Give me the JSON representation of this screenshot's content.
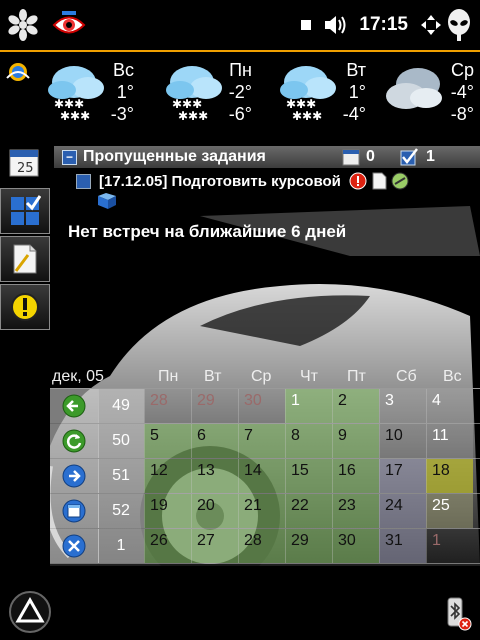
{
  "status": {
    "time": "17:15"
  },
  "weather": {
    "days": [
      {
        "name": "Вс",
        "hi": "1°",
        "lo": "-3°",
        "icon": "snow-cloud-icon"
      },
      {
        "name": "Пн",
        "hi": "-2°",
        "lo": "-6°",
        "icon": "snow-cloud-icon"
      },
      {
        "name": "Вт",
        "hi": "1°",
        "lo": "-4°",
        "icon": "snow-cloud-icon"
      },
      {
        "name": "Ср",
        "hi": "-4°",
        "lo": "-8°",
        "icon": "cloudy-icon"
      }
    ]
  },
  "tasks": {
    "header": "Пропущенные задания",
    "calendar_count": "0",
    "task_count": "1",
    "item": "[17.12.05] Подготовить курсовой",
    "no_meetings": "Нет встреч на ближайшие 6 дней",
    "calendar_icon_day": "25"
  },
  "calendar": {
    "month_label": "дек, 05",
    "weekdays": [
      "Пн",
      "Вт",
      "Ср",
      "Чт",
      "Пт",
      "Сб",
      "Вс"
    ],
    "weeks": [
      {
        "week": "49",
        "days": [
          "28",
          "29",
          "30",
          "1",
          "2",
          "3",
          "4"
        ]
      },
      {
        "week": "50",
        "days": [
          "5",
          "6",
          "7",
          "8",
          "9",
          "10",
          "11"
        ]
      },
      {
        "week": "51",
        "days": [
          "12",
          "13",
          "14",
          "15",
          "16",
          "17",
          "18"
        ]
      },
      {
        "week": "52",
        "days": [
          "19",
          "20",
          "21",
          "22",
          "23",
          "24",
          "25"
        ]
      },
      {
        "week": "1",
        "days": [
          "26",
          "27",
          "28",
          "29",
          "30",
          "31",
          "1"
        ]
      }
    ]
  },
  "colors": {
    "accent": "#f0a000",
    "weekday_cell": "#8cc86e",
    "today_cell": "#c8c828",
    "task_checkbox": "#2b5fb0"
  }
}
